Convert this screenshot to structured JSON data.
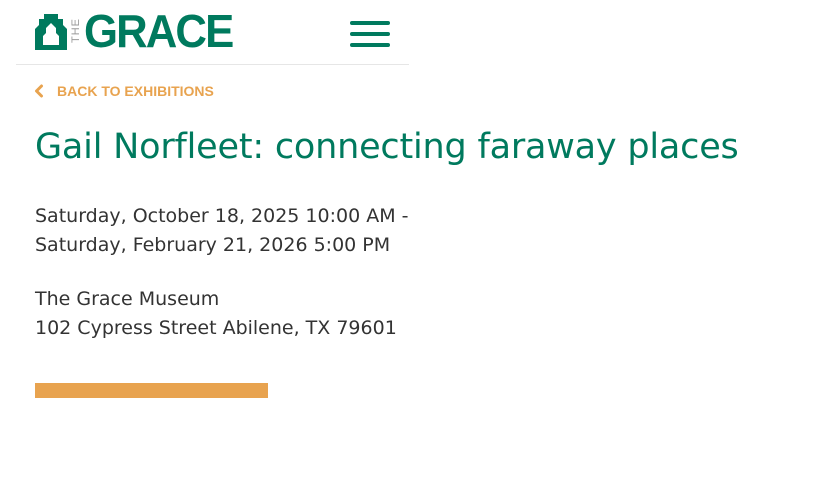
{
  "header": {
    "logo": {
      "small_text": "THE",
      "word": "GRACE"
    },
    "menu_icon": "hamburger-menu-icon"
  },
  "nav": {
    "back_label": "BACK TO EXHIBITIONS",
    "back_icon": "chevron-left-icon"
  },
  "exhibition": {
    "title": "Gail Norfleet: connecting faraway places",
    "start": "Saturday, October 18, 2025 10:00 AM -",
    "end": "Saturday, February 21, 2026 5:00 PM",
    "venue": "The Grace Museum",
    "address": "102 Cypress Street Abilene, TX 79601"
  },
  "colors": {
    "brand_green": "#007a5e",
    "accent_orange": "#e8a34f",
    "text": "#333333"
  }
}
